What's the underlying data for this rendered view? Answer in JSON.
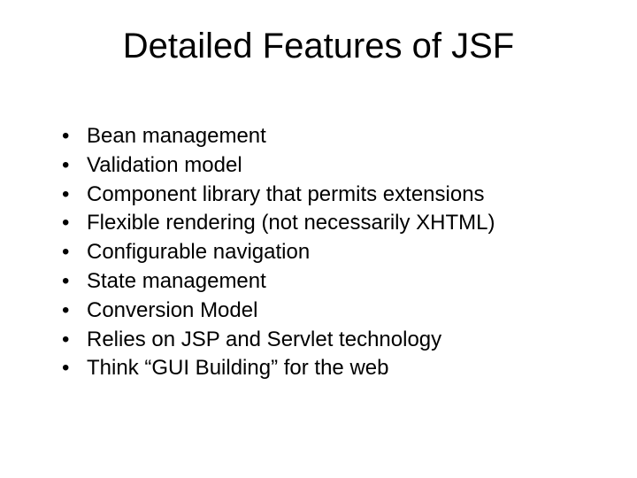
{
  "title": "Detailed Features of JSF",
  "bullets": [
    "Bean management",
    "Validation model",
    "Component library that permits extensions",
    "Flexible rendering (not necessarily XHTML)",
    "Configurable navigation",
    "State management",
    "Conversion Model",
    "Relies on JSP and Servlet technology",
    "Think “GUI Building” for the web"
  ]
}
